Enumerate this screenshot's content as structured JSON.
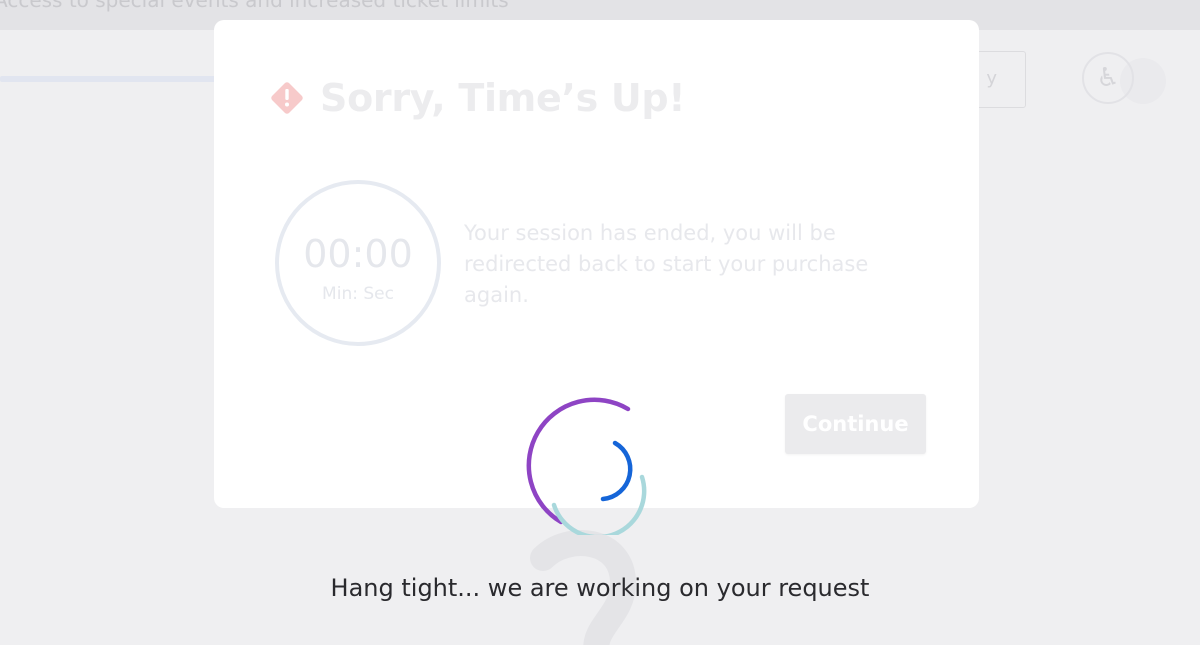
{
  "background": {
    "banner_text": "Access to special events and increased ticket limits",
    "button_label": "y",
    "accessibility_icon": "accessibility-icon"
  },
  "modal": {
    "icon": "warning-diamond-icon",
    "title": "Sorry, Time’s Up!",
    "timer": {
      "value": "00:00",
      "unit": "Min: Sec"
    },
    "message": "Your session has ended, you will be redirected back to start your purchase again.",
    "continue_label": "Continue"
  },
  "loader": {
    "message": "Hang tight... we are working on your request"
  },
  "colors": {
    "spinner_outer": "#8e44c4",
    "spinner_middle": "#a9d8dc",
    "spinner_inner": "#1565d8",
    "warning": "#f5c6c6"
  }
}
